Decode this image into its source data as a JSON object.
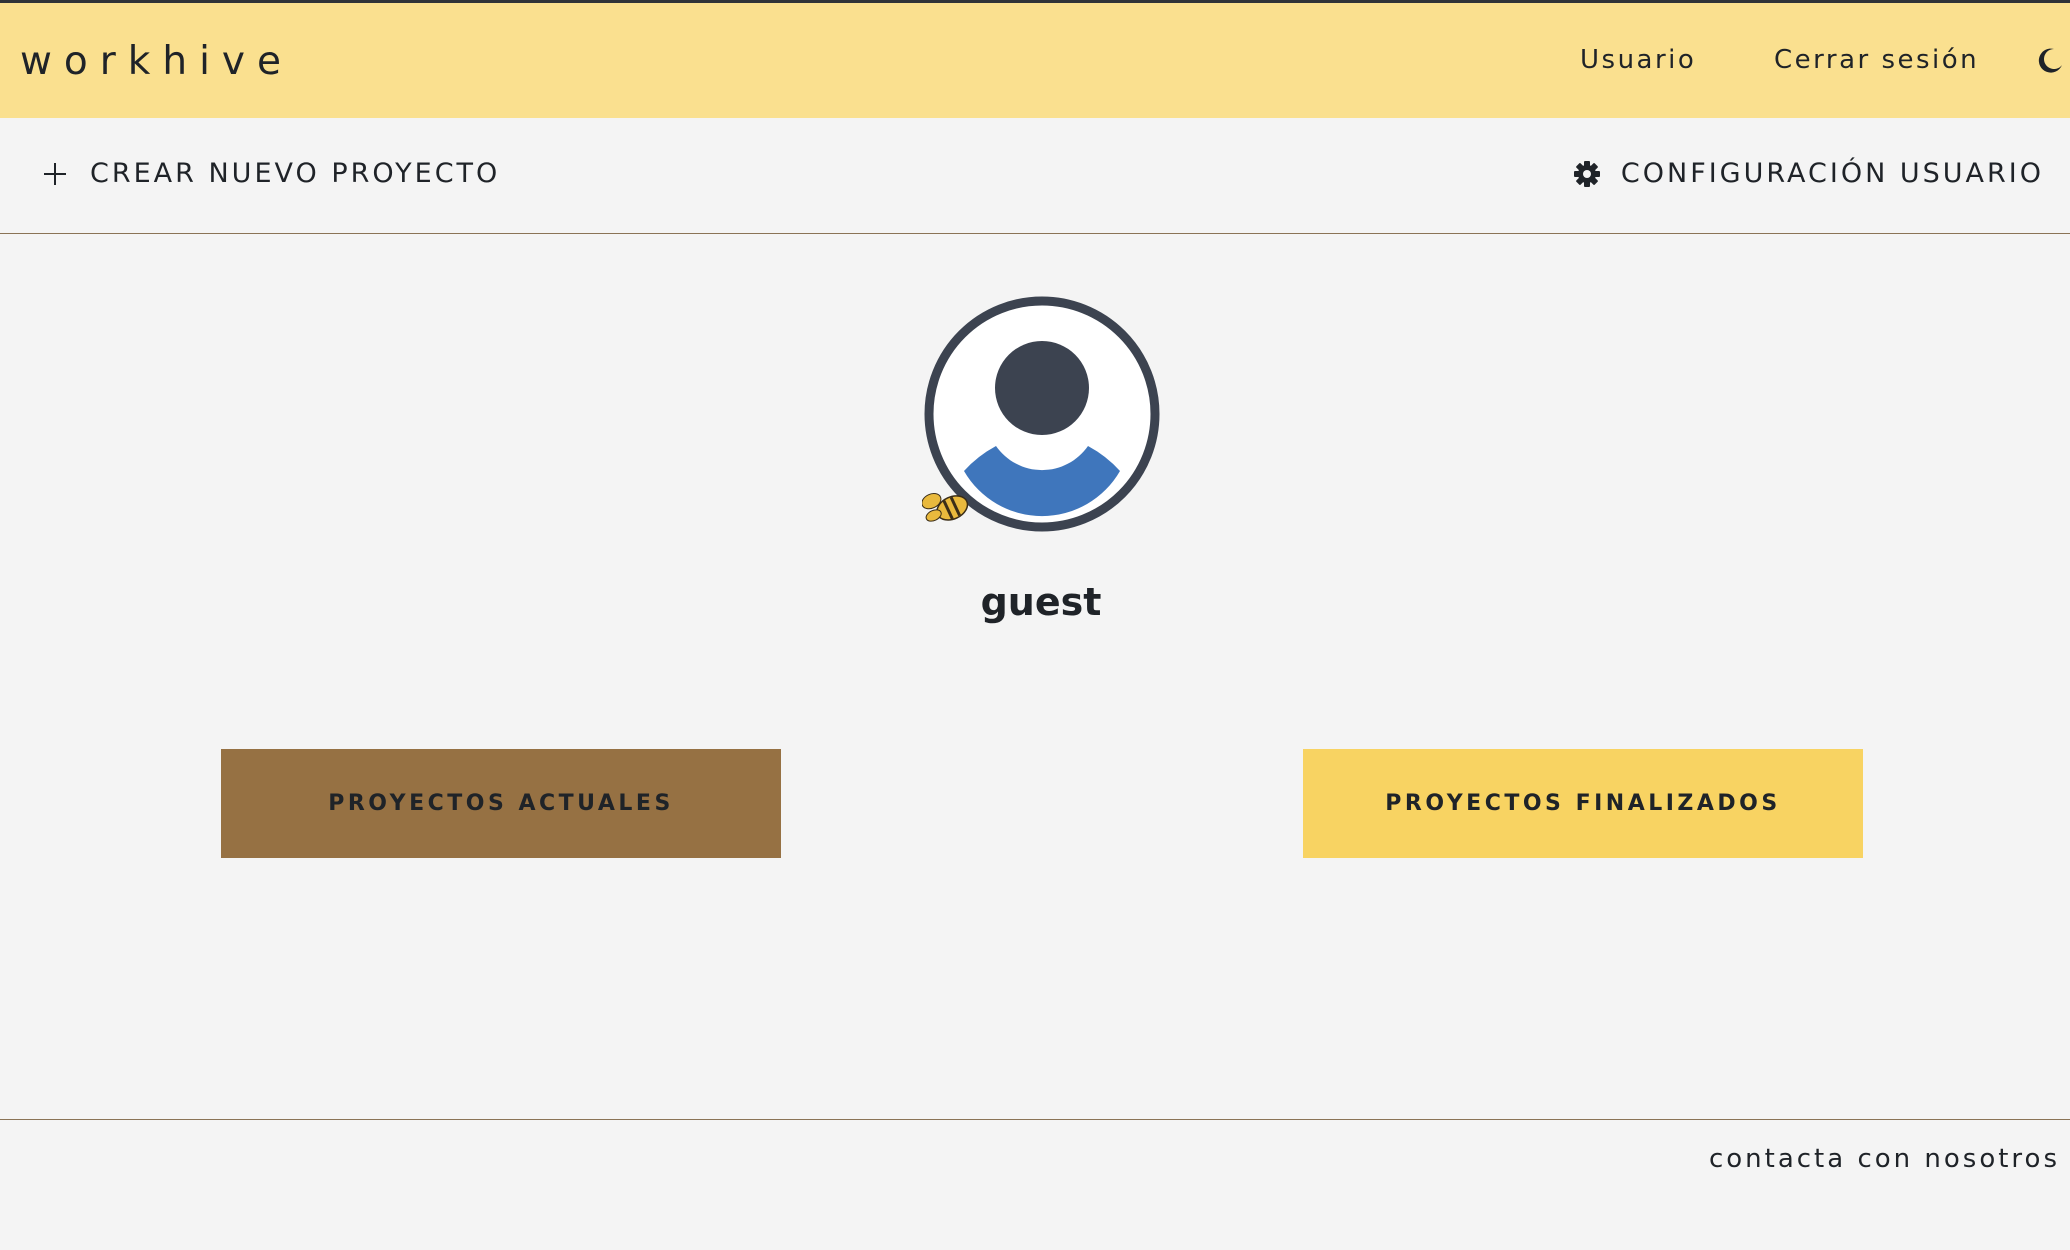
{
  "header": {
    "brand": "workhive",
    "nav": {
      "user": "Usuario",
      "logout": "Cerrar sesión"
    },
    "theme_toggle_icon": "moon-icon",
    "background_color": "#fae08f"
  },
  "actions": {
    "create_project": {
      "label": "CREAR NUEVO PROYECTO",
      "icon": "plus-icon"
    },
    "user_settings": {
      "label": "CONFIGURACIÓN USUARIO",
      "icon": "gear-icon"
    }
  },
  "profile": {
    "avatar_icon": "user-avatar-icon",
    "badge_icon": "bee-icon",
    "username": "guest"
  },
  "projects": {
    "current": {
      "label": "PROYECTOS ACTUALES",
      "color": "#967143"
    },
    "finished": {
      "label": "PROYECTOS FINALIZADOS",
      "color": "#f8d362"
    }
  },
  "footer": {
    "contact": "contacta con nosotros"
  }
}
